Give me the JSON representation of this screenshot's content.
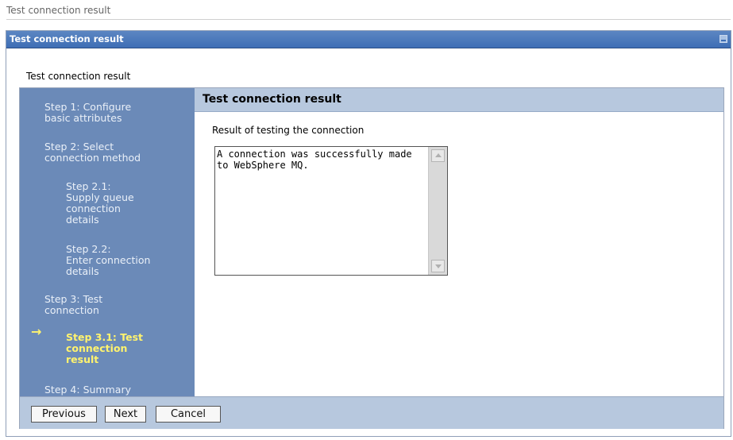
{
  "page": {
    "header": "Test connection result"
  },
  "portlet": {
    "title": "Test connection result",
    "content_label": "Test connection result"
  },
  "wizard": {
    "steps": [
      {
        "label": "Step 1: Configure\nbasic attributes"
      },
      {
        "label": "Step 2: Select\nconnection method"
      },
      {
        "label": "Step 2.1:\nSupply queue\nconnection\ndetails"
      },
      {
        "label": "Step 2.2:\nEnter connection\ndetails"
      },
      {
        "label": "Step 3: Test\nconnection"
      },
      {
        "label": "Step 3.1: Test\nconnection\nresult",
        "current": true
      },
      {
        "label": "Step 4: Summary"
      }
    ],
    "current_marker": "→",
    "main": {
      "title": "Test connection result",
      "result_label": "Result of testing the connection",
      "result_text": "A connection was successfully made\nto WebSphere MQ."
    },
    "buttons": {
      "previous": "Previous",
      "next": "Next",
      "cancel": "Cancel"
    }
  }
}
